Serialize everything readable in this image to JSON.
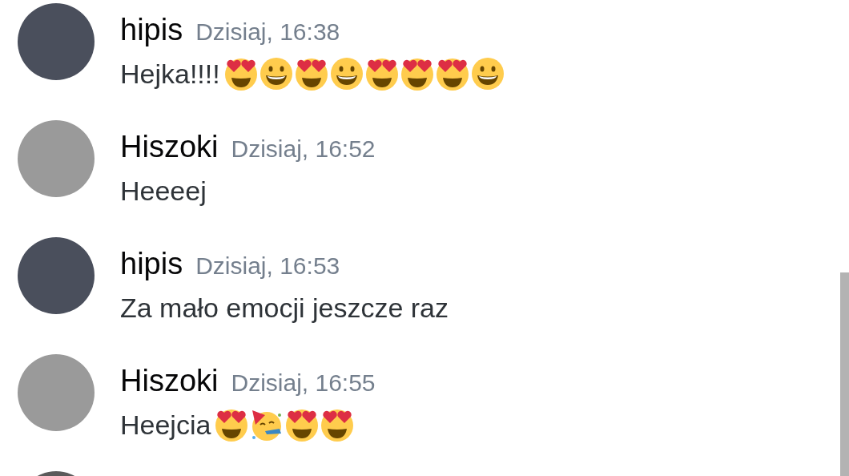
{
  "messages": [
    {
      "author": "hipis",
      "time": "Dzisiaj, 16:38",
      "color": "#4a4f5c",
      "text": "Hejka!!!!",
      "emoji": [
        {
          "kind": "heart-eyes"
        },
        {
          "kind": "grin"
        },
        {
          "kind": "heart-eyes"
        },
        {
          "kind": "grin"
        },
        {
          "kind": "heart-eyes"
        },
        {
          "kind": "heart-eyes"
        },
        {
          "kind": "heart-eyes"
        },
        {
          "kind": "grin"
        }
      ]
    },
    {
      "author": "Hiszoki",
      "time": "Dzisiaj, 16:52",
      "color": "#9a9a9a",
      "text": "Heeeej"
    },
    {
      "author": "hipis",
      "time": "Dzisiaj, 16:53",
      "color": "#4a4f5c",
      "text": "Za mało emocji jeszcze raz"
    },
    {
      "author": "Hiszoki",
      "time": "Dzisiaj, 16:55",
      "color": "#9a9a9a",
      "text": "Heejcia",
      "emoji": [
        {
          "kind": "heart-eyes"
        },
        {
          "kind": "party"
        },
        {
          "kind": "heart-eyes"
        },
        {
          "kind": "heart-eyes"
        }
      ]
    }
  ],
  "partial_avatar": {
    "color": "#5a5a5a"
  }
}
